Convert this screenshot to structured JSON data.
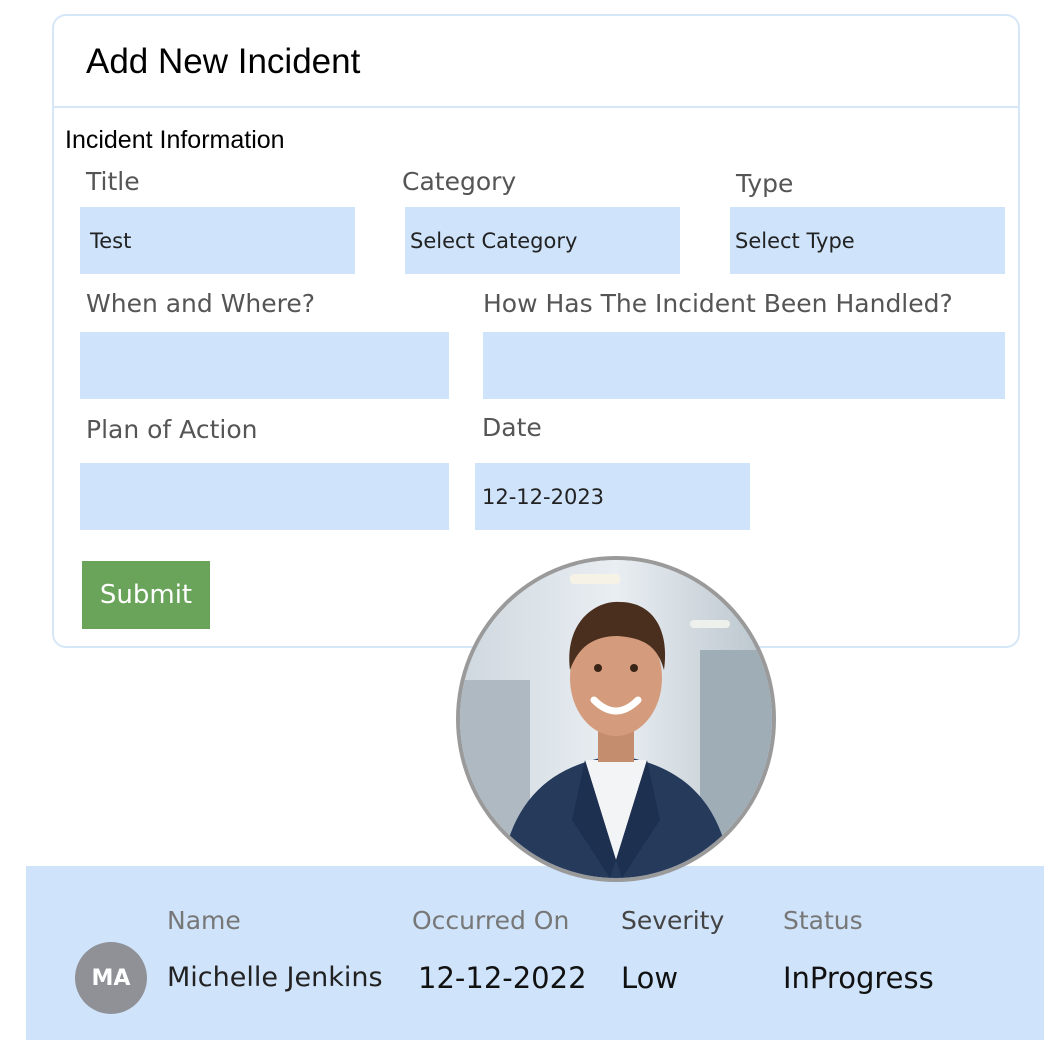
{
  "form": {
    "title": "Add New Incident",
    "section_title": "Incident Information",
    "fields": {
      "title": {
        "label": "Title",
        "value": "Test"
      },
      "category": {
        "label": "Category",
        "value": "Select Category"
      },
      "type": {
        "label": "Type",
        "value": "Select Type"
      },
      "when_where": {
        "label": "When and Where?",
        "value": ""
      },
      "handled": {
        "label": "How Has The Incident Been Handled?",
        "value": ""
      },
      "plan": {
        "label": "Plan of Action",
        "value": ""
      },
      "date": {
        "label": "Date",
        "value": "12-12-2023"
      }
    },
    "submit_label": "Submit"
  },
  "incident": {
    "initials": "MA",
    "headers": {
      "name": "Name",
      "occurred_on": "Occurred On",
      "severity": "Severity",
      "status": "Status"
    },
    "values": {
      "name": "Michelle Jenkins",
      "occurred_on": "12-12-2022",
      "severity": "Low",
      "status": "InProgress"
    }
  },
  "colors": {
    "field_bg": "#cfe3fa",
    "submit_bg": "#6aa35a",
    "card_border": "#d6e7f7",
    "initials_bg": "#8f9197"
  }
}
